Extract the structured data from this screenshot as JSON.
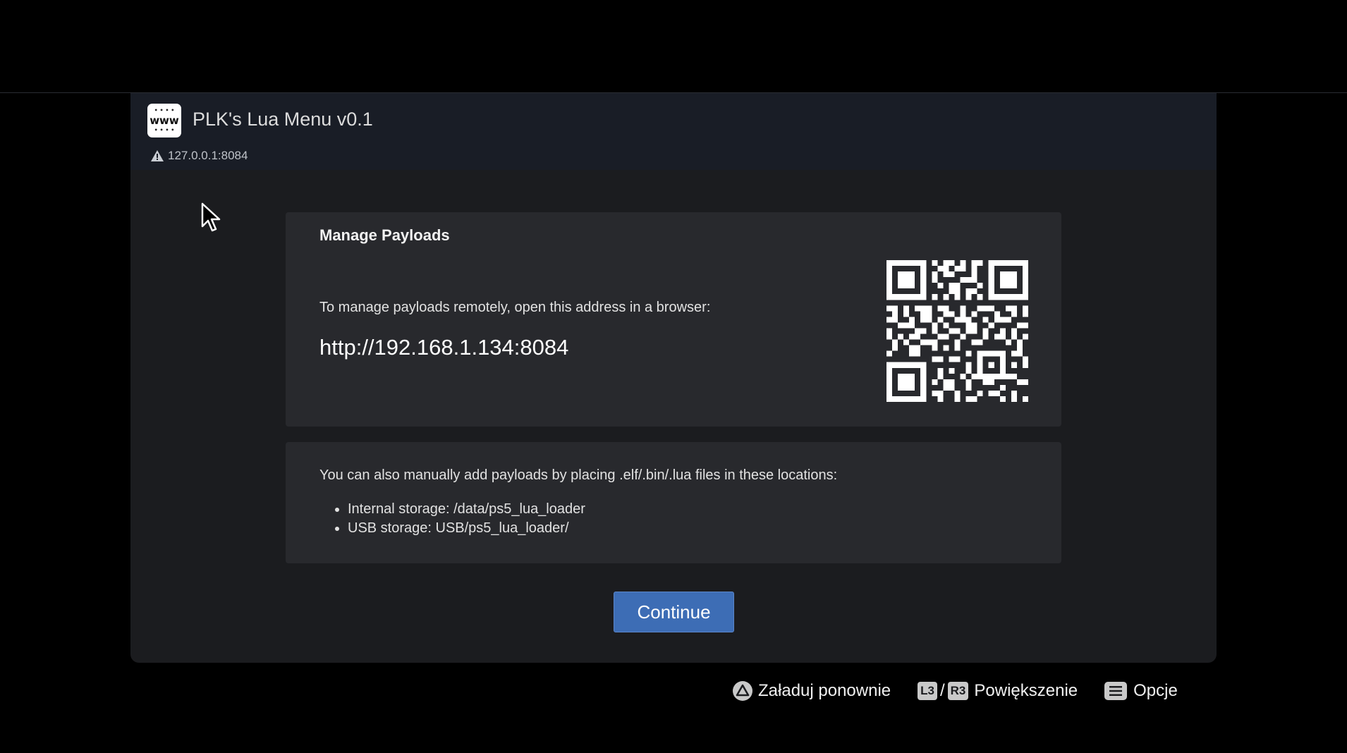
{
  "window": {
    "app_icon_text": "www",
    "title": "PLK's Lua Menu v0.1",
    "url": "127.0.0.1:8084"
  },
  "manage": {
    "title": "Manage Payloads",
    "instruction": "To manage payloads remotely, open this address in a browser:",
    "address": "http://192.168.1.134:8084"
  },
  "manual": {
    "text": "You can also manually add payloads by placing .elf/.bin/.lua files in these locations:",
    "locations": [
      "Internal storage: /data/ps5_lua_loader",
      "USB storage: USB/ps5_lua_loader/"
    ]
  },
  "continue_label": "Continue",
  "footer": {
    "reload_label": "Załaduj ponownie",
    "l3": "L3",
    "slash": "/",
    "r3": "R3",
    "zoom_label": "Powiększenie",
    "options_label": "Opcje"
  },
  "colors": {
    "background": "#000000",
    "window": "#1b1c1f",
    "header": "#191d26",
    "card": "#28292d",
    "button": "#3d6db5"
  }
}
